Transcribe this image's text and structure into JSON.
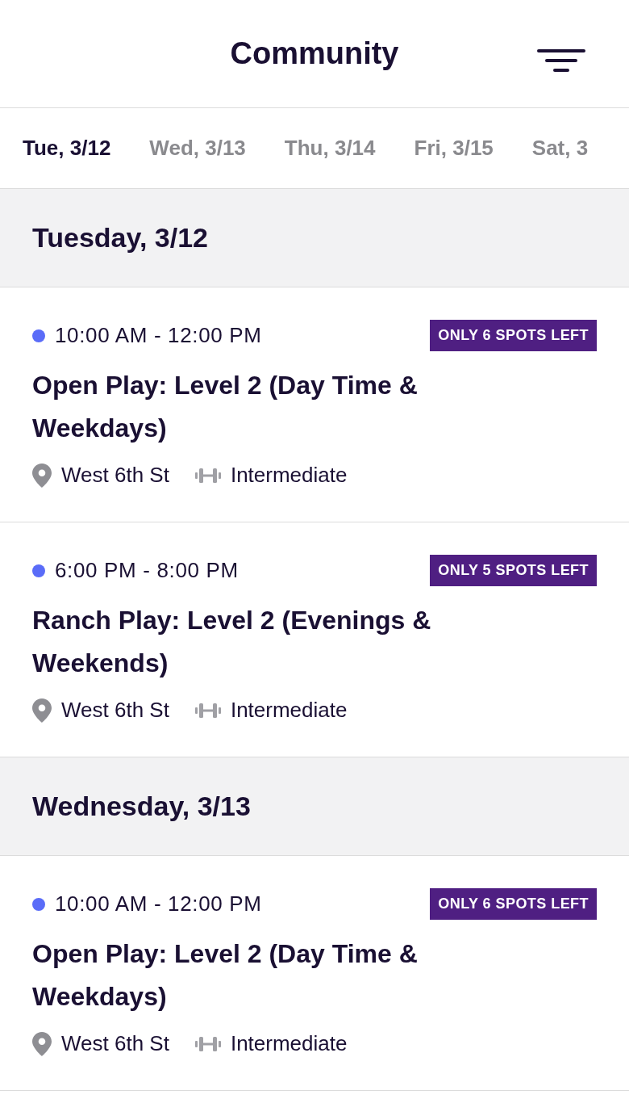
{
  "header": {
    "title": "Community"
  },
  "date_tabs": [
    {
      "label": "Tue, 3/12",
      "selected": true
    },
    {
      "label": "Wed, 3/13",
      "selected": false
    },
    {
      "label": "Thu, 3/14",
      "selected": false
    },
    {
      "label": "Fri, 3/15",
      "selected": false
    },
    {
      "label": "Sat, 3",
      "selected": false
    }
  ],
  "days": [
    {
      "heading": "Tuesday, 3/12",
      "events": [
        {
          "time": "10:00 AM - 12:00 PM",
          "badge": "ONLY 6 SPOTS LEFT",
          "title": "Open Play: Level 2 (Day Time & Weekdays)",
          "location": "West 6th St",
          "level": "Intermediate"
        },
        {
          "time": "6:00 PM - 8:00 PM",
          "badge": "ONLY 5 SPOTS LEFT",
          "title": "Ranch Play: Level 2 (Evenings & Weekends)",
          "location": "West 6th St",
          "level": "Intermediate"
        }
      ]
    },
    {
      "heading": "Wednesday, 3/13",
      "events": [
        {
          "time": "10:00 AM - 12:00 PM",
          "badge": "ONLY 6 SPOTS LEFT",
          "title": "Open Play: Level 2 (Day Time & Weekdays)",
          "location": "West 6th St",
          "level": "Intermediate"
        }
      ]
    }
  ]
}
